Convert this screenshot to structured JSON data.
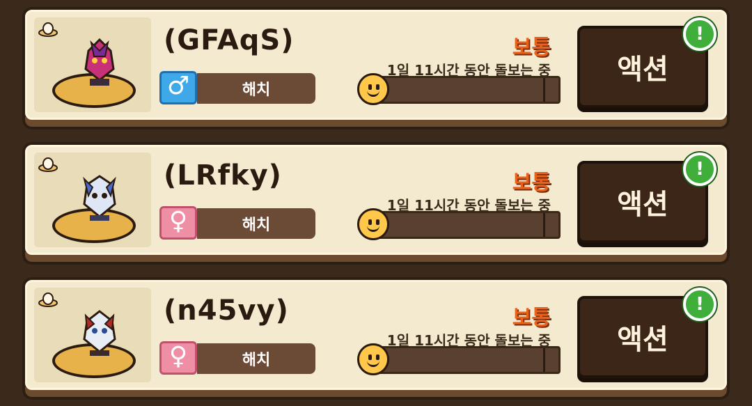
{
  "pets": [
    {
      "name": "(GFAqS)",
      "gender": "male",
      "gender_icon": "♂",
      "status": "해치",
      "mood": "보통",
      "care_text": "1일 11시간 동안 돌보는 중",
      "progress": 0.05,
      "action_label": "액션",
      "alert": "!",
      "colors": {
        "body": "#c8307a",
        "accent": "#7a2a9a"
      }
    },
    {
      "name": "(LRfky)",
      "gender": "female",
      "gender_icon": "♀",
      "status": "해치",
      "mood": "보통",
      "care_text": "1일 11시간 동안 돌보는 중",
      "progress": 0.05,
      "action_label": "액션",
      "alert": "!",
      "colors": {
        "body": "#dfe6f5",
        "accent": "#4a6ad0"
      }
    },
    {
      "name": "(n45vy)",
      "gender": "female",
      "gender_icon": "♀",
      "status": "해치",
      "mood": "보통",
      "care_text": "1일 11시간 동안 돌보는 중",
      "progress": 0.05,
      "action_label": "액션",
      "alert": "!",
      "colors": {
        "body": "#e8ecf4",
        "accent": "#b02a2a"
      }
    }
  ]
}
